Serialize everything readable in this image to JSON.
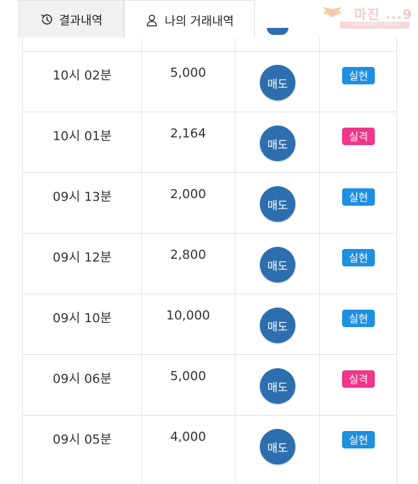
{
  "tabs": {
    "results_label": "결과내역",
    "trades_label": "나의 거래내역"
  },
  "logo": {
    "text": "마진 ...9",
    "subtext": "마진거래 검증전문 커뮤니티"
  },
  "rows": [
    {
      "time": "10시 02분",
      "amount": "5,000",
      "action": "매도",
      "result": "실현",
      "result_type": "win"
    },
    {
      "time": "10시 01분",
      "amount": "2,164",
      "action": "매도",
      "result": "실격",
      "result_type": "lose"
    },
    {
      "time": "09시 13분",
      "amount": "2,000",
      "action": "매도",
      "result": "실현",
      "result_type": "win"
    },
    {
      "time": "09시 12분",
      "amount": "2,800",
      "action": "매도",
      "result": "실현",
      "result_type": "win"
    },
    {
      "time": "09시 10분",
      "amount": "10,000",
      "action": "매도",
      "result": "실현",
      "result_type": "win"
    },
    {
      "time": "09시 06분",
      "amount": "5,000",
      "action": "매도",
      "result": "실격",
      "result_type": "lose"
    },
    {
      "time": "09시 05분",
      "amount": "4,000",
      "action": "매도",
      "result": "실현",
      "result_type": "win"
    }
  ],
  "colors": {
    "sell_button": "#2d6fae",
    "win_badge": "#1f8fe0",
    "lose_badge": "#f0358a"
  },
  "icons": {
    "results_tab": "history-icon",
    "trades_tab": "user-icon"
  }
}
